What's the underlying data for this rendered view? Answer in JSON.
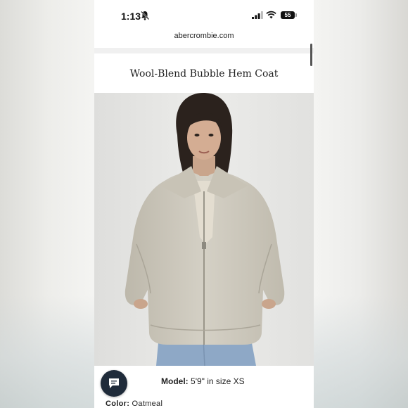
{
  "status_bar": {
    "time": "1:13",
    "battery": "55"
  },
  "browser": {
    "url": "abercrombie.com"
  },
  "product": {
    "title": "Wool-Blend Bubble Hem Coat",
    "model_label": "Model:",
    "model_value": "5'9\" in size XS",
    "color_label": "Color:",
    "color_value": "Oatmeal"
  },
  "icons": {
    "bell": "bell-slash-icon",
    "signal": "cellular-signal-icon",
    "wifi": "wifi-icon",
    "battery": "battery-icon",
    "chat": "chat-bubble-icon"
  },
  "colors": {
    "coat": "#cfcbbf",
    "jeans": "#8ea8c6",
    "chat_button": "#1f2b3a"
  }
}
